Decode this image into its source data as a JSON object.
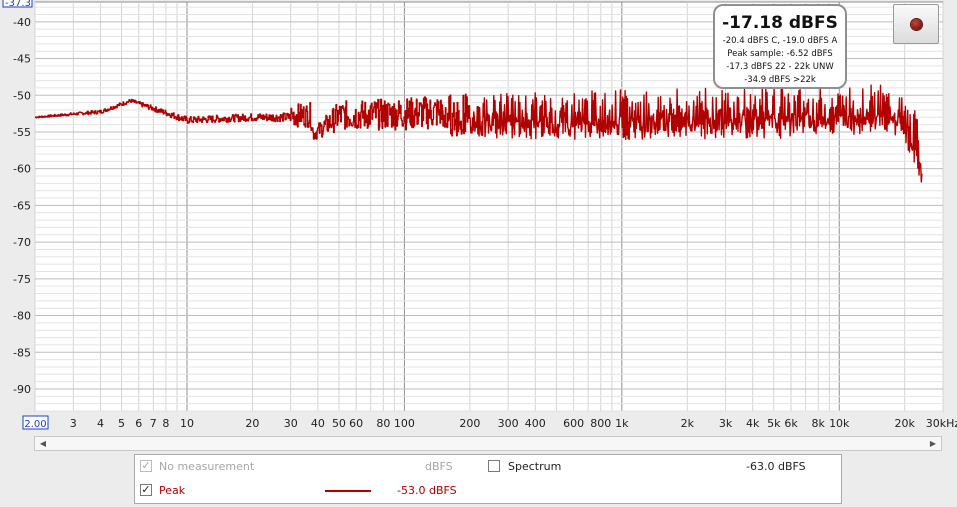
{
  "chart_data": {
    "type": "line",
    "title": "",
    "xlabel": "",
    "ylabel": "",
    "x_scale": "log",
    "xlim": [
      2,
      30000
    ],
    "ylim": [
      -93,
      -37.3
    ],
    "y_ticks": [
      -40,
      -45,
      -50,
      -55,
      -60,
      -65,
      -70,
      -75,
      -80,
      -85,
      -90
    ],
    "y_tick_labels": [
      "-40",
      "-45",
      "-50",
      "-55",
      "-60",
      "-65",
      "-70",
      "-75",
      "-80",
      "-85",
      "-90"
    ],
    "y_top_label": "-37.3",
    "x_ticks": [
      2,
      3,
      4,
      5,
      6,
      7,
      8,
      10,
      20,
      30,
      40,
      50,
      60,
      80,
      100,
      200,
      300,
      400,
      600,
      800,
      1000,
      2000,
      3000,
      4000,
      5000,
      6000,
      8000,
      10000,
      20000,
      30000
    ],
    "x_tick_labels": [
      "2.00",
      "3",
      "4",
      "5",
      "6",
      "7",
      "8",
      "10",
      "20",
      "30",
      "40",
      "50",
      "60",
      "80",
      "100",
      "200",
      "300",
      "400",
      "600",
      "800",
      "1k",
      "2k",
      "3k",
      "4k",
      "5k",
      "6k",
      "8k",
      "10k",
      "20k",
      "30kHz"
    ],
    "grid": true,
    "series": [
      {
        "name": "Peak",
        "color": "#b00000",
        "envelope": {
          "x": [
            2,
            4,
            5.5,
            10,
            20,
            37,
            38,
            50,
            100,
            150,
            200,
            500,
            1000,
            2000,
            5000,
            10000,
            15000,
            18000,
            20000,
            22000,
            24000
          ],
          "upper": [
            -52.7,
            -51.5,
            -50.0,
            -52.0,
            -51.5,
            -51.0,
            -54.5,
            -50.8,
            -50.3,
            -49.9,
            -49.8,
            -49.5,
            -49.2,
            -49.1,
            -48.8,
            -48.8,
            -48.5,
            -49.0,
            -50.5,
            -51.5,
            -54.0
          ],
          "lower": [
            -53.3,
            -53.0,
            -51.5,
            -54.8,
            -54.5,
            -55.0,
            -56.5,
            -55.5,
            -55.5,
            -55.5,
            -55.8,
            -56.0,
            -56.0,
            -56.0,
            -55.9,
            -55.5,
            -55.0,
            -55.5,
            -57.0,
            -59.0,
            -62.2
          ]
        }
      }
    ],
    "legend": [
      {
        "label": "No measurement",
        "unit": "dBFS",
        "checked": true,
        "enabled": false
      },
      {
        "label": "Peak",
        "value": "-53.0 dBFS",
        "checked": true,
        "color": "#b00000"
      },
      {
        "label": "Spectrum",
        "value": "-63.0 dBFS",
        "checked": false
      }
    ],
    "annotation": {
      "headline": "-17.18 dBFS",
      "lines": [
        "-20.4 dBFS C, -19.0 dBFS A",
        "Peak sample: -6.52 dBFS",
        "-17.3 dBFS 22 - 22k UNW",
        "-34.9 dBFS >22k"
      ]
    }
  },
  "ui": {
    "record_button": "record-icon"
  }
}
